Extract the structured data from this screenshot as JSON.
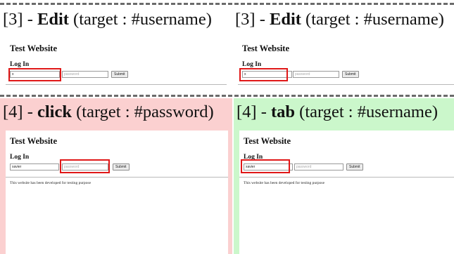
{
  "panels": [
    {
      "caption": {
        "index": "[3] - ",
        "action": "Edit",
        "target": " (target : #username)"
      },
      "site_title": "Test Website",
      "login_heading": "Log In",
      "username_value": "x",
      "password_value": "",
      "password_placeholder": "password",
      "submit_label": "Submit",
      "footer": ""
    },
    {
      "caption": {
        "index": "[3] - ",
        "action": "Edit",
        "target": " (target : #username)"
      },
      "site_title": "Test Website",
      "login_heading": "Log In",
      "username_value": "x",
      "password_value": "",
      "password_placeholder": "password",
      "submit_label": "Submit",
      "footer": ""
    },
    {
      "caption": {
        "index": "[4] - ",
        "action": "click",
        "target": " (target : #password)"
      },
      "site_title": "Test Website",
      "login_heading": "Log In",
      "username_value": "xavier",
      "password_value": "",
      "password_placeholder": "password",
      "submit_label": "Submit",
      "footer": "This website has been developed for testing purpose"
    },
    {
      "caption": {
        "index": "[4] - ",
        "action": "tab",
        "target": " (target : #username)"
      },
      "site_title": "Test Website",
      "login_heading": "Log In",
      "username_value": "xavier",
      "password_value": "",
      "password_placeholder": "password",
      "submit_label": "Submit",
      "footer": "This website has been developed for testing purpose"
    }
  ],
  "colors": {
    "highlight": "#e01818",
    "click_background": "#fbd0d0",
    "tab_background": "#cbf7cb",
    "separator": "#6b6b6b"
  }
}
